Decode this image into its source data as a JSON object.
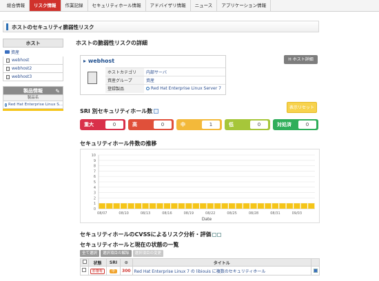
{
  "topnav": {
    "tabs": [
      "総合情報",
      "リスク情報",
      "作業記録",
      "セキュリティホール情報",
      "アドバイザリ情報",
      "ニュース",
      "アプリケーション情報"
    ],
    "active_index": 1
  },
  "page_title": "ホストのセキュリティ脆弱性リスク",
  "sidebar": {
    "host_header": "ホスト",
    "group": "資産",
    "hosts": [
      "webhost",
      "webhost2",
      "webhost3"
    ],
    "product_header": "製品情報",
    "product_column": "製品名",
    "products": [
      "Red Hat Enterprise Linux S..."
    ]
  },
  "detail": {
    "heading": "ホストの脆弱性リスクの詳細",
    "host_name": "webhost",
    "host_detail_button": "ホスト詳細",
    "rows": [
      {
        "key": "ホストカテゴリ",
        "value": "内部サーバ"
      },
      {
        "key": "資産グループ",
        "value": "資産"
      },
      {
        "key": "登録製品",
        "value": "Red Hat Enterprise Linux Server 7"
      }
    ]
  },
  "sri": {
    "heading": "SRI 別セキュリティホール数",
    "reset_button": "表示リセット",
    "badges": [
      {
        "label": "重大",
        "count": "0",
        "color": "#d9304a"
      },
      {
        "label": "高",
        "count": "0",
        "color": "#e0503a"
      },
      {
        "label": "中",
        "count": "1",
        "color": "#f3b93a"
      },
      {
        "label": "低",
        "count": "0",
        "color": "#a6c63a"
      },
      {
        "label": "対処済",
        "count": "0",
        "color": "#2fae5a"
      }
    ]
  },
  "trend": {
    "heading": "セキュリティホール件数の推移"
  },
  "chart_data": {
    "type": "bar",
    "xlabel": "Date",
    "ylabel": "",
    "ylim": [
      0,
      10
    ],
    "yticks": [
      0,
      1,
      2,
      3,
      4,
      5,
      6,
      7,
      8,
      9,
      10
    ],
    "xticks": [
      "08/07",
      "08/10",
      "08/13",
      "08/16",
      "08/19",
      "08/22",
      "08/25",
      "08/28",
      "08/31",
      "09/03"
    ],
    "categories": [
      "08/07",
      "08/08",
      "08/09",
      "08/10",
      "08/11",
      "08/12",
      "08/13",
      "08/14",
      "08/15",
      "08/16",
      "08/17",
      "08/18",
      "08/19",
      "08/20",
      "08/21",
      "08/22",
      "08/23",
      "08/24",
      "08/25",
      "08/26",
      "08/27",
      "08/28",
      "08/29",
      "08/30",
      "08/31",
      "09/01",
      "09/02",
      "09/03",
      "09/04",
      "09/05"
    ],
    "values": [
      1,
      1,
      1,
      1,
      1,
      1,
      1,
      1,
      1,
      1,
      1,
      1,
      1,
      1,
      1,
      1,
      1,
      1,
      1,
      1,
      1,
      1,
      1,
      1,
      1,
      1,
      1,
      1,
      1,
      1
    ],
    "bar_color": "#f5c518",
    "grid": true
  },
  "cvss": {
    "heading": "セキュリティホールのCVSSによるリスク分析・評価"
  },
  "vulnlist": {
    "heading": "セキュリティホールと現在の状態の一覧",
    "buttons": [
      "全て選択",
      "選択項目の解除",
      "選択項目の変更"
    ],
    "columns": [
      "状態",
      "SRI",
      "タイトル"
    ],
    "rows": [
      {
        "status": "影響有",
        "sri": "中",
        "score": "300",
        "title": "Red Hat Enterprise Linux 7 の libiouis に複数のセキュリティホール"
      }
    ]
  }
}
